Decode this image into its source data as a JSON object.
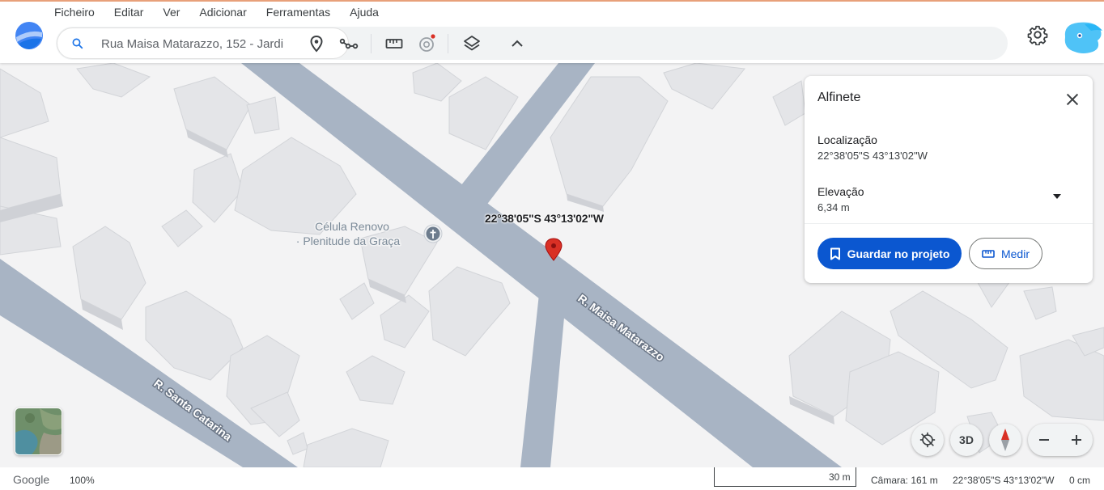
{
  "menu": [
    "Ficheiro",
    "Editar",
    "Ver",
    "Adicionar",
    "Ferramentas",
    "Ajuda"
  ],
  "search": {
    "value": "Rua Maisa Matarazzo, 152 - Jardi"
  },
  "toolbar": {
    "icons": [
      "search-icon",
      "pin-icon",
      "path-icon",
      "ruler-icon",
      "history-icon",
      "layers-icon",
      "chevron-up-icon"
    ],
    "notification_color": "#d93025"
  },
  "map": {
    "poi_label_line1": "Célula Renovo",
    "poi_label_line2": "· Plenitude da Graça",
    "street_1": "R. Maisa Matarazzo",
    "street_2": "R. Santa Catarina",
    "pin_label": "22°38'05\"S 43°13'02\"W",
    "road_color": "#a8b4c4",
    "pin_color": "#d93025"
  },
  "panel": {
    "title": "Alfinete",
    "location_label": "Localização",
    "location_value": "22°38'05\"S 43°13'02\"W",
    "elevation_label": "Elevação",
    "elevation_value": "6,34 m",
    "save_button": "Guardar no projeto",
    "measure_button": "Medir",
    "primary_color": "#0b57d0"
  },
  "controls": {
    "three_d": "3D"
  },
  "status": {
    "brand": "Google",
    "zoom": "100%",
    "scale": "30 m",
    "camera": "Câmara: 161 m",
    "coords": "22°38'05\"S 43°13'02\"W",
    "height": "0 cm"
  }
}
